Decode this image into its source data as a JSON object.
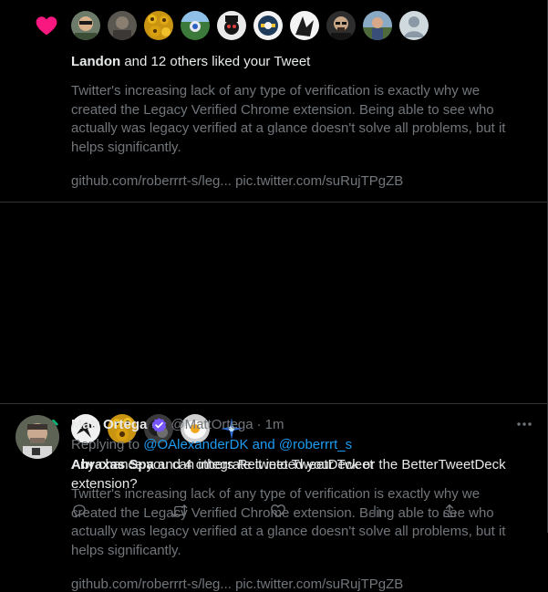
{
  "notifications": [
    {
      "kind_icon": "heart-icon",
      "kind_color": "#f91880",
      "actor": "Landon",
      "rest": " and 12 others liked your Tweet",
      "tweet_lines": [
        "Twitter's increasing lack of any type of verification is exactly why we",
        "created the Legacy Verified Chrome extension. Being able to see who",
        "actually was legacy verified at a glance doesn't solve all problems, but it",
        "helps significantly."
      ],
      "link1": "github.com/roberrrt-s/leg...",
      "link2": "pic.twitter.com/suRujTPgZB"
    },
    {
      "kind_icon": "retweet-icon",
      "kind_color": "#00ba7c",
      "actor": "Abraxas Spa",
      "rest": " and 4 others Retweeted your Tweet",
      "tweet_lines": [
        "Twitter's increasing lack of any type of verification is exactly why we",
        "created the Legacy Verified Chrome extension. Being able to see who",
        "actually was legacy verified at a glance doesn't solve all problems, but it",
        "helps significantly."
      ],
      "link1": "github.com/roberrrt-s/leg...",
      "link2": "pic.twitter.com/suRujTPgZB"
    }
  ],
  "reply": {
    "author_name": "Matt Ortega",
    "handle": "@MattOrtega",
    "dot": "·",
    "time": "1m",
    "replying_prefix": "Replying to ",
    "mention1": "@OAlexanderDK",
    "and_word": " and ",
    "mention2": "@roberrrt_s",
    "text_lines": [
      "Any chance you can integrate it into TweetDeck or the BetterTweetDeck",
      "extension?"
    ],
    "actions": [
      "reply-icon",
      "retweet-icon",
      "like-icon",
      "views-icon",
      "share-icon"
    ]
  },
  "colors": {
    "background": "#000000",
    "text_primary": "#e7e9ea",
    "text_secondary": "#71767b",
    "divider": "#2f3336",
    "link": "#1d9bf0",
    "like": "#f91880",
    "retweet": "#00ba7c",
    "verified": "#7856ff"
  }
}
